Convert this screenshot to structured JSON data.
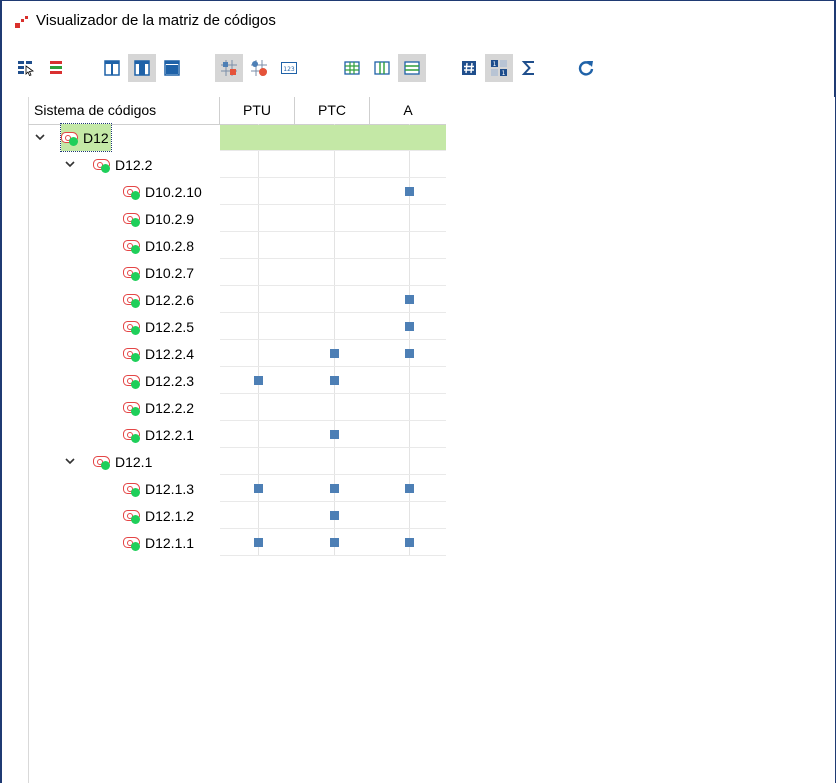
{
  "window": {
    "title": "Visualizador de la matriz de códigos"
  },
  "toolbar": {
    "buttons": [
      {
        "icon": "select-cursor-icon",
        "pressed": false
      },
      {
        "icon": "color-bars-icon",
        "pressed": false
      },
      {
        "icon": "columns-narrow-icon",
        "pressed": false
      },
      {
        "icon": "columns-medium-icon",
        "pressed": true
      },
      {
        "icon": "columns-wide-icon",
        "pressed": false
      },
      {
        "icon": "symbol-squares-icon",
        "pressed": true
      },
      {
        "icon": "symbol-circles-icon",
        "pressed": false
      },
      {
        "icon": "numbers-123-icon",
        "pressed": false
      },
      {
        "icon": "grid-all-icon",
        "pressed": false
      },
      {
        "icon": "grid-columns-icon",
        "pressed": false
      },
      {
        "icon": "grid-rows-icon",
        "pressed": true
      },
      {
        "icon": "hash-icon",
        "pressed": false
      },
      {
        "icon": "binary-icon",
        "pressed": true
      },
      {
        "icon": "sigma-icon",
        "pressed": false
      },
      {
        "icon": "refresh-icon",
        "pressed": false
      }
    ]
  },
  "grid": {
    "header_codes": "Sistema de códigos",
    "columns": [
      "PTU",
      "PTC",
      "A"
    ],
    "rows": [
      {
        "label": "D12",
        "level": 0,
        "expandable": true,
        "selected": true,
        "marks": [
          false,
          false,
          false
        ]
      },
      {
        "label": "D12.2",
        "level": 1,
        "expandable": true,
        "selected": false,
        "marks": [
          false,
          false,
          false
        ]
      },
      {
        "label": "D10.2.10",
        "level": 2,
        "expandable": false,
        "selected": false,
        "marks": [
          false,
          false,
          true
        ]
      },
      {
        "label": "D10.2.9",
        "level": 2,
        "expandable": false,
        "selected": false,
        "marks": [
          false,
          false,
          false
        ]
      },
      {
        "label": "D10.2.8",
        "level": 2,
        "expandable": false,
        "selected": false,
        "marks": [
          false,
          false,
          false
        ]
      },
      {
        "label": "D10.2.7",
        "level": 2,
        "expandable": false,
        "selected": false,
        "marks": [
          false,
          false,
          false
        ]
      },
      {
        "label": "D12.2.6",
        "level": 2,
        "expandable": false,
        "selected": false,
        "marks": [
          false,
          false,
          true
        ]
      },
      {
        "label": "D12.2.5",
        "level": 2,
        "expandable": false,
        "selected": false,
        "marks": [
          false,
          false,
          true
        ]
      },
      {
        "label": "D12.2.4",
        "level": 2,
        "expandable": false,
        "selected": false,
        "marks": [
          false,
          true,
          true
        ]
      },
      {
        "label": "D12.2.3",
        "level": 2,
        "expandable": false,
        "selected": false,
        "marks": [
          true,
          true,
          false
        ]
      },
      {
        "label": "D12.2.2",
        "level": 2,
        "expandable": false,
        "selected": false,
        "marks": [
          false,
          false,
          false
        ]
      },
      {
        "label": "D12.2.1",
        "level": 2,
        "expandable": false,
        "selected": false,
        "marks": [
          false,
          true,
          false
        ]
      },
      {
        "label": "D12.1",
        "level": 1,
        "expandable": true,
        "selected": false,
        "marks": [
          false,
          false,
          false
        ]
      },
      {
        "label": "D12.1.3",
        "level": 2,
        "expandable": false,
        "selected": false,
        "marks": [
          true,
          true,
          true
        ]
      },
      {
        "label": "D12.1.2",
        "level": 2,
        "expandable": false,
        "selected": false,
        "marks": [
          false,
          true,
          false
        ]
      },
      {
        "label": "D12.1.1",
        "level": 2,
        "expandable": false,
        "selected": false,
        "marks": [
          true,
          true,
          true
        ]
      }
    ]
  },
  "colors": {
    "selection": "#c4e8a6",
    "mark": "#4d7fb5",
    "code_tag": "#e44646",
    "code_dot": "#1fcf5a"
  }
}
